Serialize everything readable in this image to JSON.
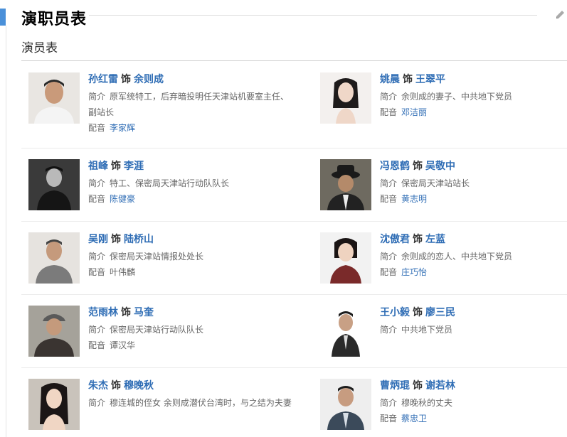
{
  "header": {
    "title": "演职员表",
    "subtitle": "演员表"
  },
  "labels": {
    "as": "饰",
    "intro": "简介",
    "voice": "配音"
  },
  "cast": [
    {
      "actor": "孙红雷",
      "role": "余则成",
      "intro": "原军统特工，后弃暗投明任天津站机要室主任、副站长",
      "voice": "李家辉",
      "voice_link": true
    },
    {
      "actor": "姚晨",
      "role": "王翠平",
      "intro": "余则成的妻子、中共地下党员",
      "voice": "邓洁丽",
      "voice_link": true
    },
    {
      "actor": "祖峰",
      "role": "李涯",
      "intro": "特工、保密局天津站行动队队长",
      "voice": "陈健豪",
      "voice_link": true
    },
    {
      "actor": "冯恩鹤",
      "role": "吴敬中",
      "intro": "保密局天津站站长",
      "voice": "黄志明",
      "voice_link": true
    },
    {
      "actor": "吴刚",
      "role": "陆桥山",
      "intro": "保密局天津站情报处处长",
      "voice": "叶伟麟",
      "voice_link": false
    },
    {
      "actor": "沈傲君",
      "role": "左蓝",
      "intro": "余则成的恋人、中共地下党员",
      "voice": "庄巧怡",
      "voice_link": true
    },
    {
      "actor": "范雨林",
      "role": "马奎",
      "intro": "保密局天津站行动队队长",
      "voice": "谭汉华",
      "voice_link": false
    },
    {
      "actor": "王小毅",
      "role": "廖三民",
      "intro": "中共地下党员",
      "voice": "",
      "voice_link": false
    },
    {
      "actor": "朱杰",
      "role": "穆晚秋",
      "intro": "穆连城的侄女 余则成潜伏台湾时，与之结为夫妻",
      "voice": "",
      "voice_link": false
    },
    {
      "actor": "曹炳琨",
      "role": "谢若林",
      "intro": "穆晚秋的丈夫",
      "voice": "蔡忠卫",
      "voice_link": true
    }
  ]
}
